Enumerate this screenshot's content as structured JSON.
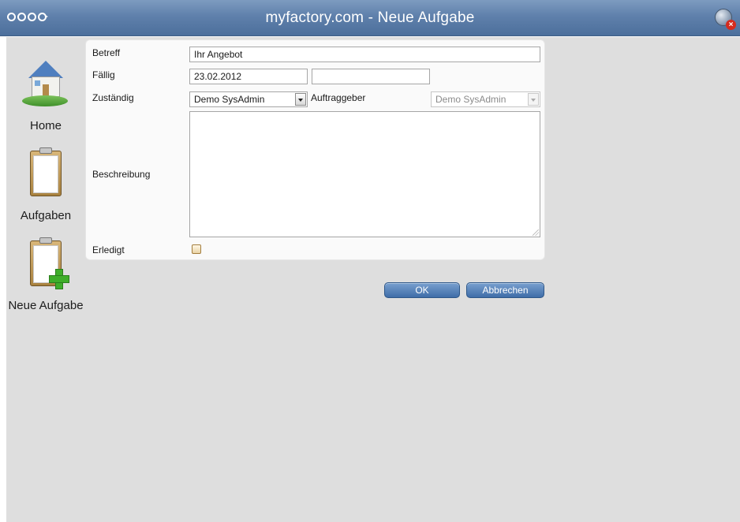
{
  "window": {
    "title": "myfactory.com - Neue Aufgabe",
    "close_badge": "×"
  },
  "sidebar": {
    "items": [
      {
        "label": "Home",
        "icon": "house-icon"
      },
      {
        "label": "Aufgaben",
        "icon": "clipboard-icon"
      },
      {
        "label": "Neue Aufgabe",
        "icon": "clipboard-add-icon"
      }
    ]
  },
  "form": {
    "betreff": {
      "label": "Betreff",
      "value": "Ihr Angebot"
    },
    "faellig": {
      "label": "Fällig",
      "date": "23.02.2012",
      "time": ""
    },
    "zustaendig": {
      "label": "Zuständig",
      "value": "Demo SysAdmin"
    },
    "auftraggeber": {
      "label": "Auftraggeber",
      "value": "Demo SysAdmin"
    },
    "beschreibung": {
      "label": "Beschreibung",
      "value": ""
    },
    "erledigt": {
      "label": "Erledigt",
      "checked": false
    }
  },
  "buttons": {
    "ok": "OK",
    "cancel": "Abbrechen"
  },
  "colors": {
    "titlebar": "#5f80ab",
    "background": "#dedede",
    "button": "#4f7cb7"
  }
}
